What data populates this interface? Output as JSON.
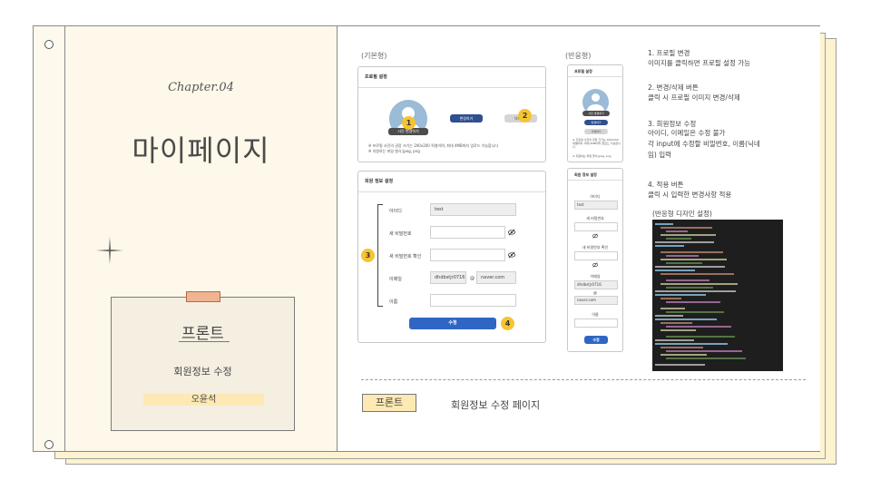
{
  "left_page": {
    "chapter": "Chapter.04",
    "title": "마이페이지",
    "card": {
      "title": "프론트",
      "subtitle": "회원정보 수정",
      "name": "오윤석"
    }
  },
  "labels": {
    "basic": "(기본형)",
    "responsive": "(반응형)"
  },
  "profile_panel": {
    "header": "프로필 설정",
    "photo_badge": "사진 변경하기",
    "change_button": "변경하기",
    "delete_button": "삭제하기",
    "note1": "※ 프로필 사진의 권장 크기는 200x200 픽셀이며, 최대 4MB까지 업로드 가능합니다",
    "note2": "※ 지원하는 파일 형식:jpeg, png"
  },
  "member_panel": {
    "header": "회원 정보 설정",
    "fields": {
      "id_label": "아이디",
      "id_value": "test",
      "new_pw_label": "새 비밀번호",
      "new_pw_confirm_label": "새 비밀번호 확인",
      "email_label": "이메일",
      "email_id": "dhdbstjr0716",
      "email_at": "@",
      "email_domain": "naver.com",
      "name_label": "이름"
    },
    "submit": "수정"
  },
  "badges": [
    "1",
    "2",
    "3",
    "4"
  ],
  "mobile": {
    "profile_header": "프로필 설정",
    "photo_badge": "사진 변경하기",
    "change_button": "변경하기",
    "delete_button": "삭제하기",
    "note": "※ 프로필 사진의 권장 크기는 200x200 픽셀이며, 최대 4MB까지 업로드 가능합니다",
    "note2": "※ 지원하는 파일 형식:jpeg, png",
    "member_header": "회원 정보 설정",
    "id_label": "아이디",
    "id_value": "test",
    "new_pw_label": "새 비밀번호",
    "new_pw_confirm_label": "새 비밀번호 확인",
    "email_label": "이메일",
    "email_id": "dhdbstjr0716",
    "email_at": "@",
    "email_domain": "naver.com",
    "name_label": "이름",
    "submit": "수정"
  },
  "descriptions": [
    {
      "title": "1. 프로필 변경",
      "body": "이미지를 클릭하면 프로필 설정 가능"
    },
    {
      "title": "2. 변경/삭제 버튼",
      "body": "클릭 시 프로필 이미지 변경/삭제"
    },
    {
      "title": "3. 회원정보 수정",
      "body": "아이디, 이메일은 수정 불가\n각 input에 수정할 비밀번호, 이름(닉네\n임) 입력"
    },
    {
      "title": "4. 적용 버튼",
      "body": "클릭 시 입력한 변경사항 적용"
    }
  ],
  "code_title": "(반응형 디자인 설정)",
  "footer": {
    "tag": "프론트",
    "text": "회원정보 수정 페이지"
  },
  "colors": {
    "accent_yellow": "#f6c431",
    "primary_blue": "#2f66c4",
    "dark_blue": "#2f4f8f",
    "paper": "#fdf3cf"
  }
}
